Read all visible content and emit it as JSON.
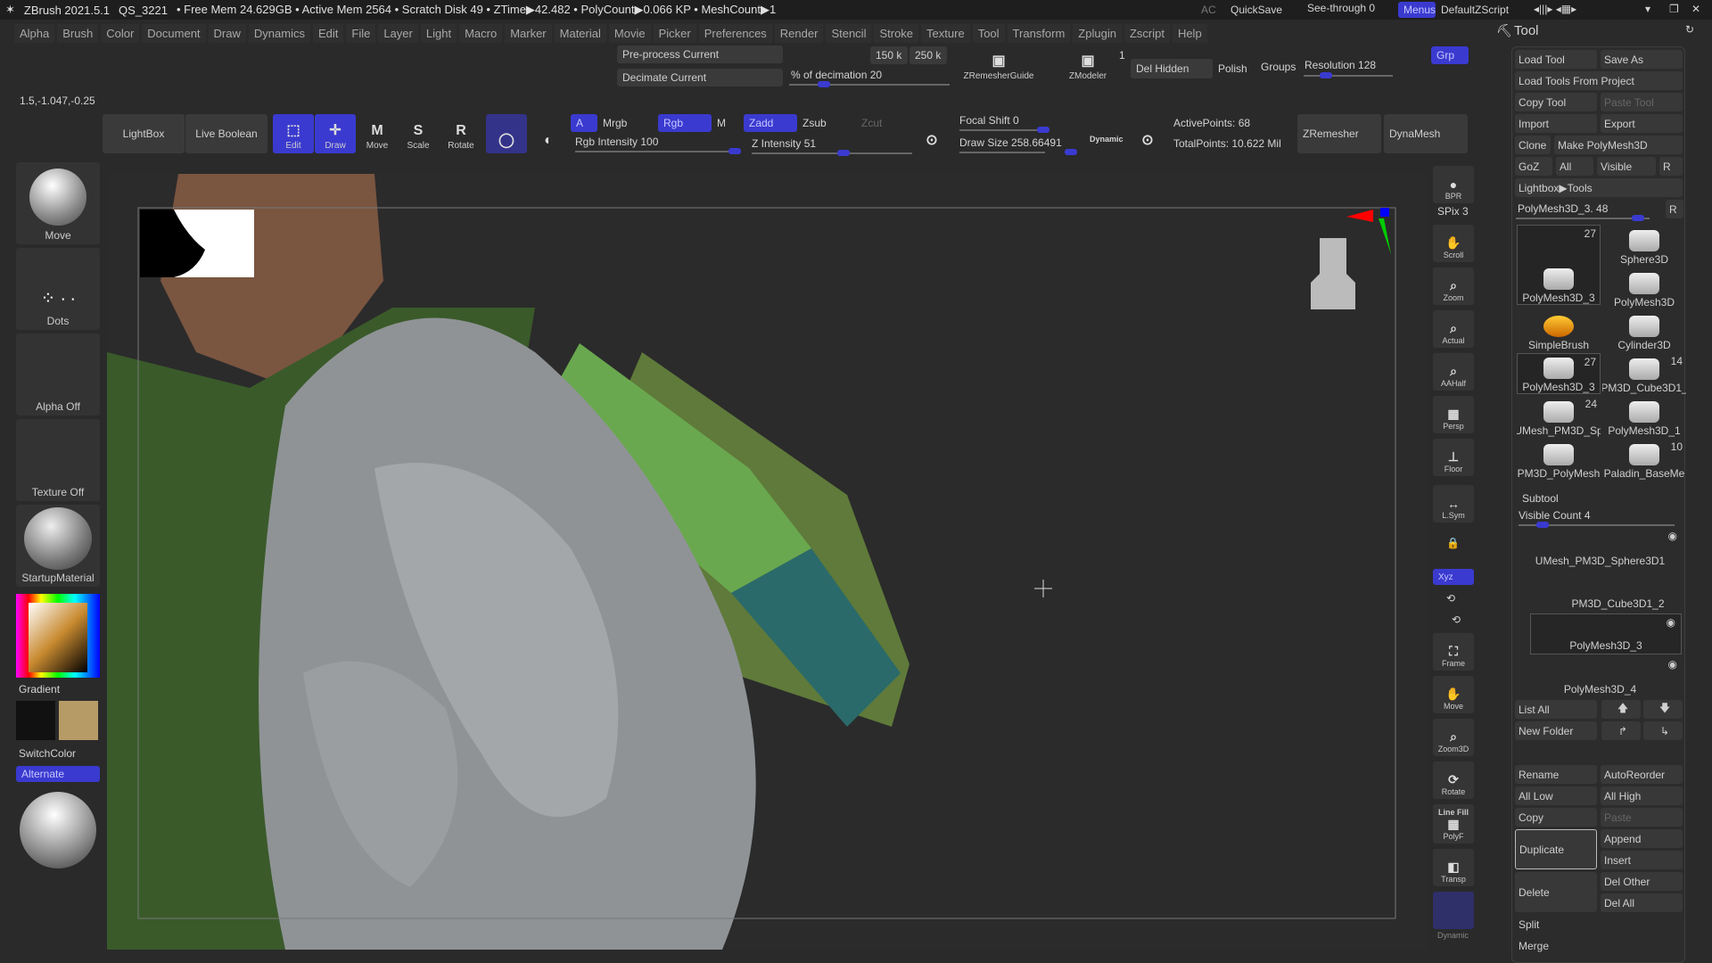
{
  "titlebar": {
    "app": "ZBrush 2021.5.1",
    "project": "QS_3221",
    "stats": "• Free Mem 24.629GB • Active Mem 2564 • Scratch Disk 49 • ZTime▶42.482 • PolyCount▶0.066 KP • MeshCount▶1",
    "ac": "AC",
    "quicksave": "QuickSave",
    "seethrough": "See-through  0",
    "menus": "Menus",
    "script": "DefaultZScript"
  },
  "menus": [
    "Alpha",
    "Brush",
    "Color",
    "Document",
    "Draw",
    "Dynamics",
    "Edit",
    "File",
    "Layer",
    "Light",
    "Macro",
    "Marker",
    "Material",
    "Movie",
    "Picker",
    "Preferences",
    "Render",
    "Stencil",
    "Stroke",
    "Texture",
    "Tool",
    "Transform",
    "Zplugin",
    "Zscript",
    "Help"
  ],
  "shelf": {
    "coords": "1.5,-1.047,-0.25",
    "preprocess": "Pre-process Current",
    "decimate": "Decimate Current",
    "decimation": "% of decimation 20",
    "k150": "150 k",
    "k250": "250 k",
    "zremesherguide": "ZRemesherGuide",
    "zmodeler": "ZModeler",
    "zmodeler_count": "1",
    "delhidden": "Del Hidden",
    "polish": "Polish",
    "groups": "Groups",
    "resolution": "Resolution 128",
    "grp": "Grp",
    "lightbox": "LightBox",
    "liveboolean": "Live Boolean",
    "edit": "Edit",
    "draw": "Draw",
    "move": "Move",
    "scale": "Scale",
    "rotate": "Rotate",
    "a": "A",
    "mrgb": "Mrgb",
    "rgb": "Rgb",
    "m": "M",
    "zadd": "Zadd",
    "zsub": "Zsub",
    "zcut": "Zcut",
    "rgbint": "Rgb Intensity 100",
    "zint": "Z Intensity 51",
    "focal": "Focal Shift 0",
    "drawsize": "Draw Size 258.66491",
    "dynamic": "Dynamic",
    "active": "ActivePoints: 68",
    "total": "TotalPoints: 10.622 Mil",
    "zremesher": "ZRemesher",
    "dynamesh": "DynaMesh"
  },
  "left": [
    "Move",
    "Dots",
    "Alpha Off",
    "Texture Off",
    "StartupMaterial"
  ],
  "left_extra": {
    "gradient": "Gradient",
    "switchcolor": "SwitchColor",
    "alternate": "Alternate"
  },
  "right": [
    {
      "icon": "bpr-icon",
      "label": "BPR"
    },
    {
      "icon": "scroll-icon",
      "label": "Scroll"
    },
    {
      "icon": "zoom-icon",
      "label": "Zoom"
    },
    {
      "icon": "actual-icon",
      "label": "Actual"
    },
    {
      "icon": "aahalf-icon",
      "label": "AAHalf"
    },
    {
      "icon": "persp-icon",
      "label": "Persp"
    },
    {
      "icon": "floor-icon",
      "label": "Floor"
    },
    {
      "icon": "lsym-icon",
      "label": "L.Sym"
    },
    {
      "icon": "frame-icon",
      "label": "Frame"
    },
    {
      "icon": "move-icon",
      "label": "Move"
    },
    {
      "icon": "zoom3d-icon",
      "label": "Zoom3D"
    },
    {
      "icon": "rotate-icon",
      "label": "Rotate"
    },
    {
      "icon": "polyf-icon",
      "label": "PolyF"
    },
    {
      "icon": "transp-icon",
      "label": "Transp"
    }
  ],
  "right_extra": {
    "spix": "SPix 3",
    "xyz": "Xyz",
    "linefill": "Line Fill",
    "dynamic": "Dynamic"
  },
  "tool": {
    "title": "Tool",
    "buttons": [
      "Load Tool",
      "Save As",
      "Load Tools From Project",
      "Copy Tool",
      "Paste Tool",
      "Import",
      "Export",
      "Clone",
      "Make PolyMesh3D",
      "GoZ",
      "All",
      "Visible",
      "R",
      "Lightbox▶Tools"
    ],
    "slider": "PolyMesh3D_3. 48",
    "r": "R",
    "thumbs": [
      {
        "name": "PolyMesh3D_3",
        "count": "27"
      },
      {
        "name": "Sphere3D",
        "count": ""
      },
      {
        "name": "PolyMesh3D",
        "count": ""
      },
      {
        "name": "SimpleBrush",
        "count": ""
      },
      {
        "name": "Cylinder3D",
        "count": ""
      },
      {
        "name": "PolyMesh3D_3",
        "count": "27"
      },
      {
        "name": "PM3D_Cube3D1_",
        "count": "14"
      },
      {
        "name": "UMesh_PM3D_Sp",
        "count": "24"
      },
      {
        "name": "PolyMesh3D_1",
        "count": ""
      },
      {
        "name": "PM3D_PolyMesh",
        "count": ""
      },
      {
        "name": "Paladin_BaseMe",
        "count": "10"
      }
    ]
  },
  "subtool": {
    "title": "Subtool",
    "visible": "Visible Count 4",
    "items": [
      "UMesh_PM3D_Sphere3D1",
      "PM3D_Cube3D1_2",
      "PolyMesh3D_3",
      "PolyMesh3D_4"
    ],
    "buttons": [
      "List All",
      "New Folder",
      "Rename",
      "AutoReorder",
      "All Low",
      "All High",
      "Copy",
      "Paste",
      "Duplicate",
      "Append",
      "Insert",
      "Delete",
      "Del Other",
      "Del All",
      "Split",
      "Merge"
    ]
  },
  "colors": {
    "accent": "#3a3ad0",
    "bg": "#2a2a2a",
    "green": "#6aa84f"
  }
}
